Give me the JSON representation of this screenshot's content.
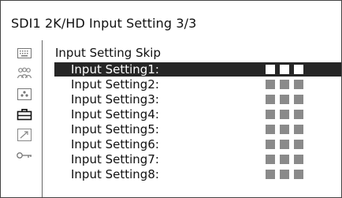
{
  "title": "SDI1 2K/HD Input Setting 3/3",
  "sidebar": {
    "icons": [
      "keyboard-icon",
      "people-icon",
      "dots-icon",
      "toolbox-icon",
      "arrow-up-right-icon",
      "key-icon"
    ]
  },
  "menu": {
    "heading": "Input Setting Skip",
    "items": [
      {
        "label": "Input Setting1:",
        "state": "selected"
      },
      {
        "label": "Input Setting2:",
        "state": "normal"
      },
      {
        "label": "Input Setting3:",
        "state": "normal"
      },
      {
        "label": "Input Setting4:",
        "state": "normal"
      },
      {
        "label": "Input Setting5:",
        "state": "normal"
      },
      {
        "label": "Input Setting6:",
        "state": "normal"
      },
      {
        "label": "Input Setting7:",
        "state": "normal"
      },
      {
        "label": "Input Setting8:",
        "state": "normal"
      }
    ]
  },
  "colors": {
    "selected_background": "#262626",
    "selected_text": "#ffffff",
    "inactive_block": "#8a8a8a",
    "active_block": "#ffffff"
  }
}
